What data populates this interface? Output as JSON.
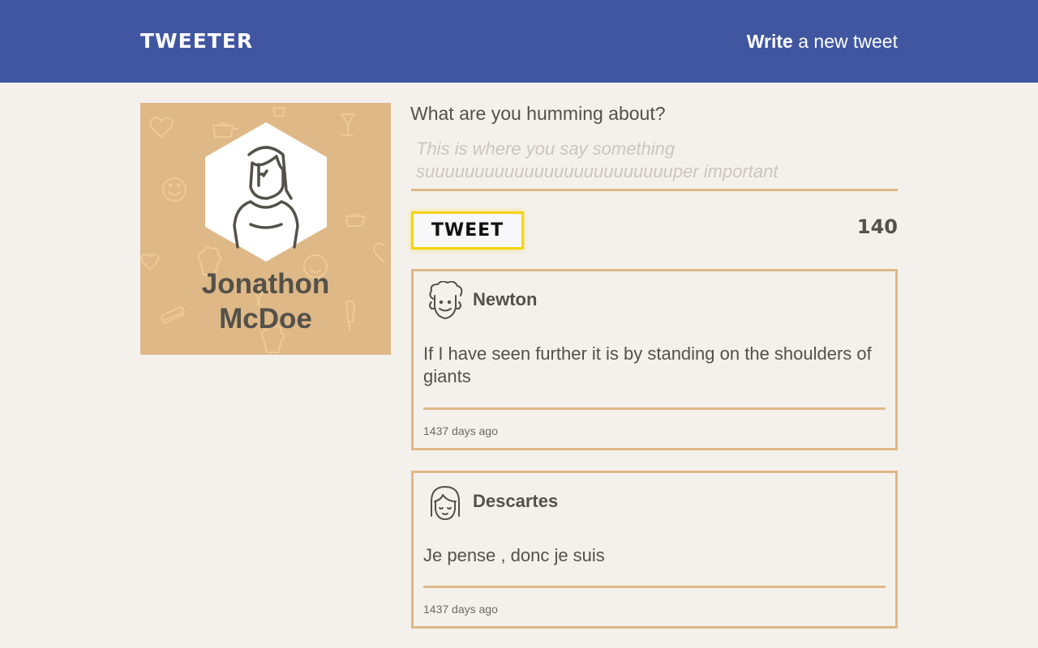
{
  "header": {
    "logo": "TWEETER",
    "write_strong": "Write",
    "write_rest": " a new tweet"
  },
  "profile": {
    "first_name": "Jonathon",
    "last_name": "McDoe",
    "avatar_icon": "woman-avatar-icon"
  },
  "compose": {
    "label": "What are you humming about?",
    "placeholder": "This is where you say something suuuuuuuuuuuuuuuuuuuuuuuuuper important",
    "button_label": "TWEET",
    "counter": "140"
  },
  "tweets": [
    {
      "author": "Newton",
      "avatar_icon": "curly-hair-man-avatar-icon",
      "text": "If I have seen further it is by standing on the shoulders of giants",
      "time": "1437 days ago"
    },
    {
      "author": "Descartes",
      "avatar_icon": "bob-hair-avatar-icon",
      "text": "Je pense , donc je suis",
      "time": "1437 days ago"
    }
  ],
  "colors": {
    "topbar": "#4056a1",
    "background": "#f4f1ec",
    "accent": "#deb887",
    "button_border": "#f6d30e",
    "text": "#545149"
  }
}
